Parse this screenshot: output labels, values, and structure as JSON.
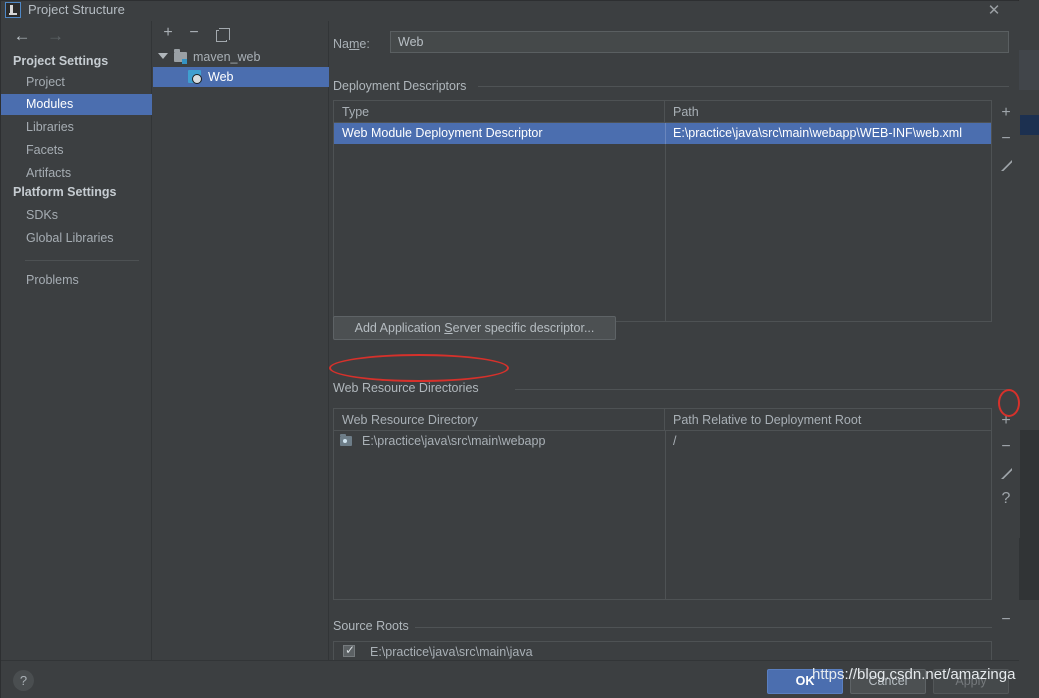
{
  "window": {
    "title": "Project Structure",
    "app_icon": "intellij-idea-icon",
    "close_label": "✕"
  },
  "nav": {
    "back": "←",
    "forward": "→"
  },
  "sidebar": {
    "groups": [
      {
        "label": "Project Settings"
      },
      {
        "label": "Platform Settings"
      }
    ],
    "project_settings_items": [
      {
        "label": "Project",
        "selected": false
      },
      {
        "label": "Modules",
        "selected": true
      },
      {
        "label": "Libraries",
        "selected": false
      },
      {
        "label": "Facets",
        "selected": false
      },
      {
        "label": "Artifacts",
        "selected": false
      }
    ],
    "platform_settings_items": [
      {
        "label": "SDKs",
        "selected": false
      },
      {
        "label": "Global Libraries",
        "selected": false
      }
    ],
    "problems_item": {
      "label": "Problems",
      "selected": false
    }
  },
  "tree_toolbar": {
    "add": "+",
    "remove": "−",
    "copy": "copy-icon"
  },
  "module_tree": {
    "root": {
      "label": "maven_web",
      "icon": "folder-icon",
      "expanded": true
    },
    "children": [
      {
        "label": "Web",
        "icon": "web-module-icon",
        "selected": true
      }
    ]
  },
  "main": {
    "name_field": {
      "label_prefix": "Na",
      "label_mnemonic": "m",
      "label_suffix": "e:",
      "value": "Web",
      "placeholder": ""
    },
    "deployment_descriptors": {
      "section_title": "Deployment Descriptors",
      "columns": [
        "Type",
        "Path"
      ],
      "rows": [
        {
          "type": "Web Module Deployment Descriptor",
          "path": "E:\\practice\\java\\src\\main\\webapp\\WEB-INF\\web.xml",
          "selected": true
        }
      ],
      "toolbar": [
        "+",
        "−",
        "edit-pencil-icon"
      ]
    },
    "add_descriptor_button": {
      "prefix": "Add Application ",
      "mnemonic": "S",
      "suffix": "erver specific descriptor..."
    },
    "web_resource_directories": {
      "section_title": "Web Resource Directories",
      "columns": [
        "Web Resource Directory",
        "Path Relative to Deployment Root"
      ],
      "rows": [
        {
          "directory": "E:\\practice\\java\\src\\main\\webapp",
          "relative_path": "/",
          "icon": "folder-icon"
        }
      ],
      "toolbar": [
        "+",
        "−",
        "edit-pencil-icon",
        "?"
      ]
    },
    "source_roots": {
      "section_title": "Source Roots",
      "rows": [
        {
          "path": "E:\\practice\\java\\src\\main\\java",
          "checked": true
        }
      ],
      "toolbar": [
        "−"
      ]
    }
  },
  "footer": {
    "help": "?",
    "ok": "OK",
    "cancel": "Cancel",
    "apply": "Apply"
  },
  "watermark": "https://blog.csdn.net/amazinga",
  "colors": {
    "background": "#3c3f41",
    "selection_blue": "#4b6eaf",
    "annotation_red": "#d6312b",
    "text": "#a9b0b6"
  }
}
